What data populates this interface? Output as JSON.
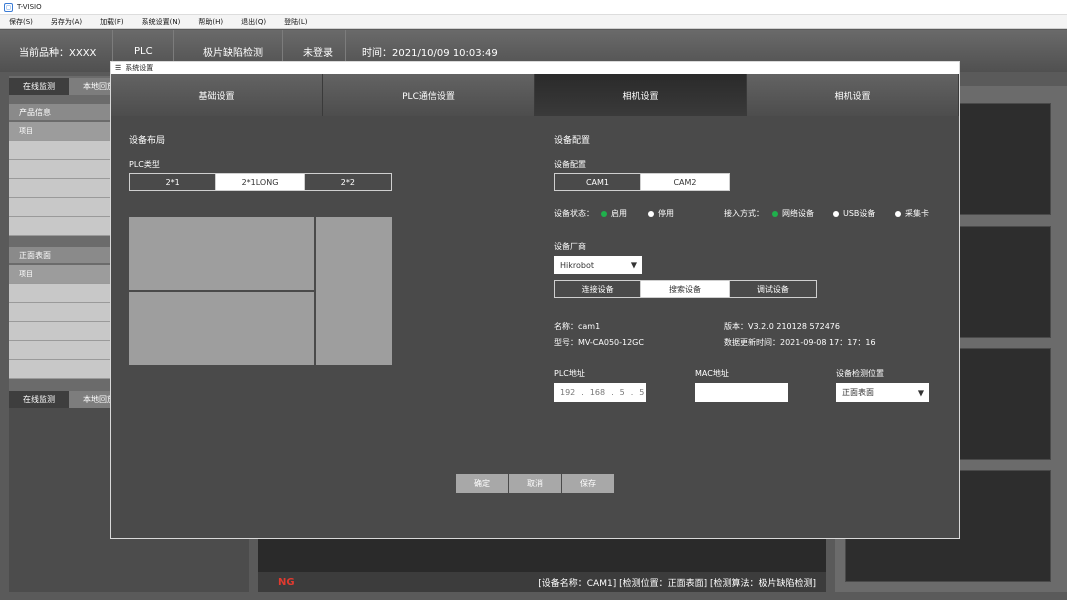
{
  "window": {
    "title": "T-VISIO"
  },
  "menu": [
    "保存(S)",
    "另存为(A)",
    "加载(F)",
    "系统设置(N)",
    "帮助(H)",
    "退出(Q)",
    "登陆(L)"
  ],
  "header": {
    "product": "当前品种：XXXX",
    "plc": "PLC",
    "mode": "极片缺陷检测",
    "login": "未登录",
    "time": "时间：2021/10/09 10:03:49"
  },
  "left_panel": {
    "tab_monitor": "在线监测",
    "tab_local": "本地回放",
    "product_info": "产品信息",
    "item": "项目",
    "front_surface": "正面表面",
    "item2": "项目",
    "tab_monitor2": "在线监测",
    "tab_local2": "本地回放"
  },
  "bottom_bar": {
    "ng": "NG",
    "info": "[设备名称：CAM1] [检测位置：正面表面] [检测算法：极片缺陷检测]"
  },
  "dialog": {
    "title": "系统设置",
    "tabs": [
      "基础设置",
      "PLC通信设置",
      "相机设置",
      "相机设置"
    ],
    "active_tab": 2,
    "layout": {
      "heading": "设备布局",
      "plc_type_label": "PLC类型",
      "plc_types": [
        "2*1",
        "2*1LONG",
        "2*2"
      ],
      "selected": "2*1LONG"
    },
    "config": {
      "heading": "设备配置",
      "sub_label": "设备配置",
      "cams": [
        "CAM1",
        "CAM2"
      ],
      "selected_cam": "CAM1",
      "status_label": "设备状态：",
      "status_enabled": "启用",
      "status_disabled": "停用",
      "access_label": "接入方式：",
      "access_network": "网络设备",
      "access_usb": "USB设备",
      "access_capture": "采集卡",
      "vendor_label": "设备厂商",
      "vendor_value": "Hikrobot",
      "actions": [
        "连接设备",
        "搜索设备",
        "调试设备"
      ],
      "selected_action": "搜索设备",
      "name_line": "名称：cam1",
      "model_line": "型号：MV-CA050-12GC",
      "version_line": "版本：V3.2.0  210128 572476",
      "update_line": "数据更新时间：2021-09-08  17：17：16",
      "plc_addr_label": "PLC地址",
      "ip": [
        "192",
        "168",
        "5",
        "5"
      ],
      "mac_label": "MAC地址",
      "mac_value": "",
      "position_label": "设备检测位置",
      "position_value": "正面表面"
    },
    "buttons": {
      "ok": "确定",
      "cancel": "取消",
      "save": "保存"
    }
  },
  "colors": {
    "accent_green": "#1fb04c",
    "ng_red": "#e03a2f",
    "dialog_bg": "#4a4a4a"
  }
}
